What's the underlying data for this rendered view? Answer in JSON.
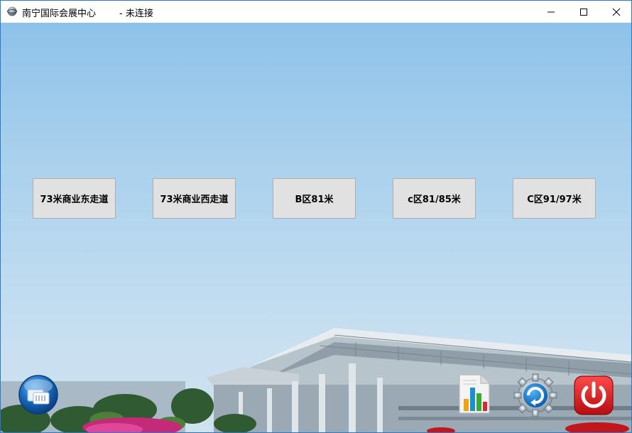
{
  "window": {
    "title": "南宁国际会展中心",
    "status": " - 未连接",
    "controls": {
      "minimize": "minimize",
      "maximize": "maximize",
      "close": "close"
    }
  },
  "zones": [
    {
      "label": "73米商业东走道"
    },
    {
      "label": "73米商业西走道"
    },
    {
      "label": "B区81米"
    },
    {
      "label": "c区81/85米"
    },
    {
      "label": "C区91/97米"
    }
  ],
  "toolbar": {
    "left_icon": "connect-icon",
    "right_icons": [
      "report-chart-icon",
      "settings-gear-icon",
      "power-icon"
    ]
  },
  "colors": {
    "accent": "#2b78c8",
    "button_bg": "#e1e1e1",
    "power_red": "#d0121a"
  }
}
